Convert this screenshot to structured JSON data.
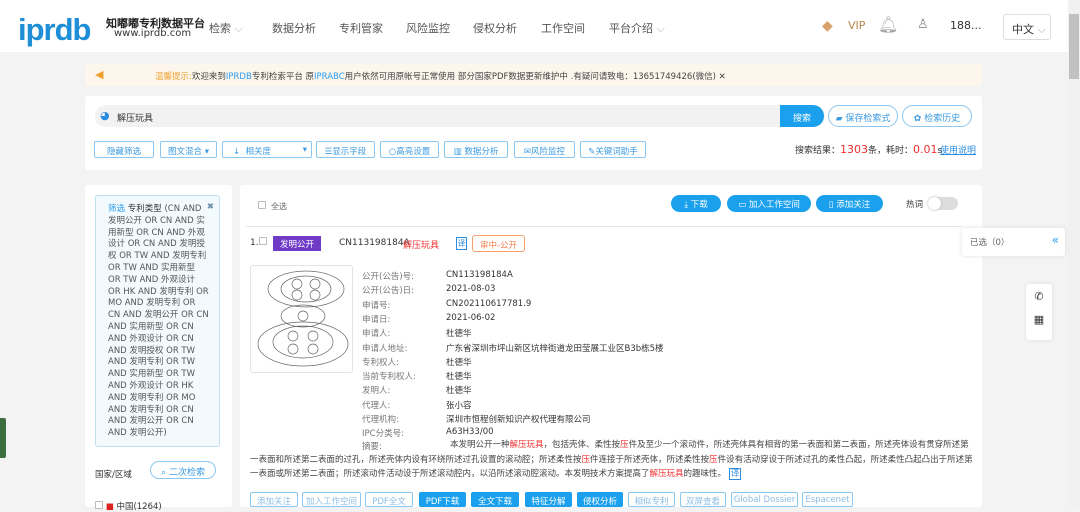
{
  "header": {
    "logo": "iprdb",
    "brand_name": "知嘟嘟专利数据平台",
    "brand_url": "www.iprdb.com",
    "nav": [
      "检索",
      "数据分析",
      "专利管家",
      "风险监控",
      "侵权分析",
      "工作空间",
      "平台介绍"
    ],
    "vip": "VIP",
    "user": "188...",
    "language": "中文"
  },
  "notice": {
    "label": "温馨提示:",
    "text1": "欢迎来到",
    "brand1": "IPRDB",
    "text2": "专利检索平台  原",
    "brand2": "IPRABC",
    "text3": "用户依然可用原帐号正常使用   部分国家PDF数据更新维护中 .有疑问请致电：13651749426(微信)"
  },
  "search": {
    "query": "解压玩具",
    "search_button": "搜索",
    "save_button": "保存检索式",
    "history_button": "检索历史"
  },
  "toolbar": {
    "hide_filter": "隐藏筛选",
    "view_mode": "图文混合",
    "sort": "相关度",
    "fields": "显示字段",
    "highlight": "高亮设置",
    "analysis": "数据分析",
    "monitor": "风险监控",
    "keyword_helper": "关键词助手"
  },
  "results": {
    "label": "搜索结果：",
    "count": "1303",
    "unit": "条，耗时：",
    "time": "0.01",
    "time_unit": "s",
    "help": "使用说明"
  },
  "filter": {
    "title": "筛选",
    "field": "专利类型",
    "expr": "(CN AND 发明公开 OR CN AND 实用新型 OR CN AND 外观设计 OR CN AND 发明授权 OR TW AND 发明专利 OR TW AND 实用新型 OR TW AND 外观设计 OR HK AND 发明专利 OR MO AND 发明专利 OR CN AND 发明公开 OR CN AND 实用新型 OR CN AND 外观设计 OR CN AND 发明授权 OR TW AND 发明专利 OR TW AND 实用新型 OR TW AND 外观设计 OR HK AND 发明专利 OR MO AND 发明专利 OR CN AND 发明公开 OR CN AND 发明公开)",
    "country_label": "国家/区域",
    "second_search": "二次检索",
    "country_item": "中国(1264)"
  },
  "list": {
    "select_all": "全选",
    "download": "下载",
    "add_workspace": "加入工作空间",
    "add_follow": "添加关注",
    "hot_words": "热词",
    "selected": "已选（0）"
  },
  "patent": {
    "index": "1.",
    "type": "发明公开",
    "number": "CN113198184A",
    "title": "解压玩具",
    "translate": "译",
    "status": "审中-公开",
    "fields": [
      {
        "label": "公开(公告)号:",
        "value": "CN113198184A"
      },
      {
        "label": "公开(公告)日:",
        "value": "2021-08-03"
      },
      {
        "label": "申请号:",
        "value": "CN202110617781.9"
      },
      {
        "label": "申请日:",
        "value": "2021-06-02"
      },
      {
        "label": "申请人:",
        "value": "杜德华"
      },
      {
        "label": "申请人地址:",
        "value": "广东省深圳市坪山新区坑梓街道龙田莹展工业区B3b栋5楼"
      },
      {
        "label": "专利权人:",
        "value": "杜德华"
      },
      {
        "label": "当前专利权人:",
        "value": "杜德华"
      },
      {
        "label": "发明人:",
        "value": "杜德华"
      },
      {
        "label": "代理人:",
        "value": "张小容"
      },
      {
        "label": "代理机构:",
        "value": "深圳市恒程创新知识产权代理有限公司"
      },
      {
        "label": "IPC分类号:",
        "value": "A63H33/00"
      }
    ],
    "abstract_label": "摘要:",
    "abstract": [
      "本发明公开一种",
      "解压玩具",
      "，包括壳体、柔性按",
      "压",
      "件及至少一个滚动件，所述壳体具有相背的第一表面和第二表面，所述壳体设有贯穿所述第一表面和所述第二表面的过孔，所述壳体内设有环绕所述过孔设置的滚动腔；所述柔性按",
      "压",
      "件连接于所述壳体，所述柔性按",
      "压",
      "件设有活动穿设于所述过孔的柔性凸起，所述柔性凸起凸出于所述第一表面或所述第二表面；所述滚动件活动设于所述滚动腔内，以沿所述滚动腔滚动。本发明技术方案提高了",
      "解压玩具",
      "的趣味性。"
    ],
    "actions": [
      "添加关注",
      "加入工作空间",
      "PDF全文",
      "PDF下载",
      "全文下载",
      "特征分解",
      "侵权分析",
      "相似专利",
      "双屏查看",
      "Global Dossier",
      "Espacenet"
    ]
  }
}
